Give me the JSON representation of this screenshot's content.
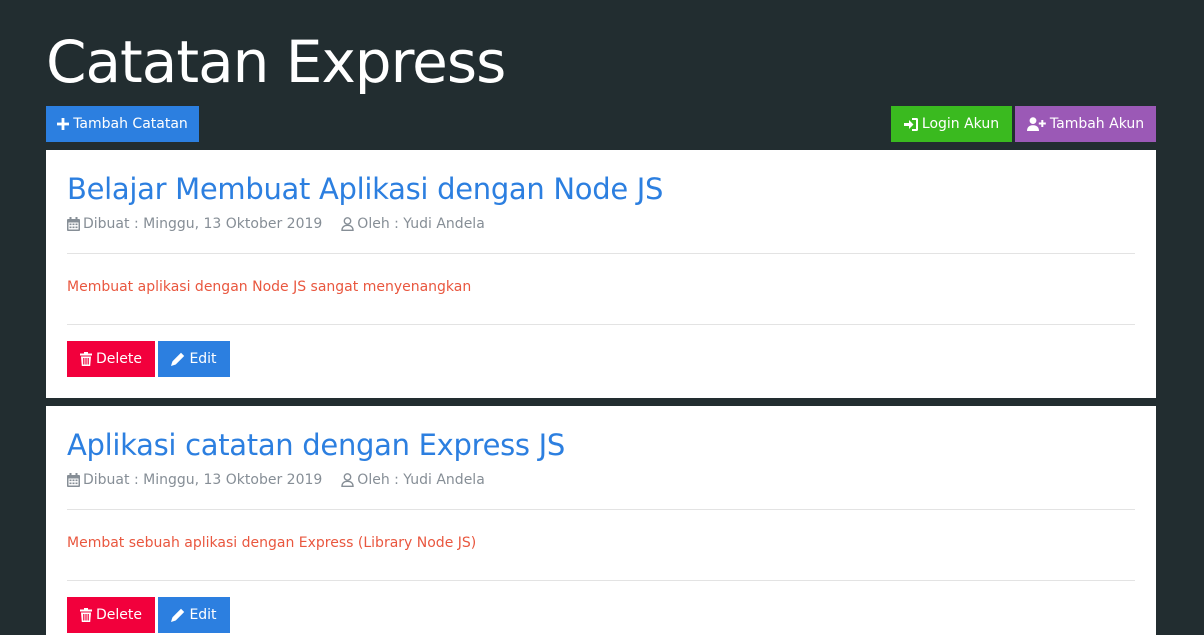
{
  "header": {
    "title": "Catatan Express",
    "add_note_label": "Tambah Catatan",
    "login_label": "Login Akun",
    "add_user_label": "Tambah Akun"
  },
  "notes": [
    {
      "title": "Belajar Membuat Aplikasi dengan Node JS",
      "created": "Dibuat : Minggu, 13 Oktober 2019",
      "author": "Oleh : Yudi Andela",
      "content": "Membuat aplikasi dengan Node JS sangat menyenangkan",
      "delete_label": "Delete",
      "edit_label": "Edit"
    },
    {
      "title": "Aplikasi catatan dengan Express JS",
      "created": "Dibuat : Minggu, 13 Oktober 2019",
      "author": "Oleh : Yudi Andela",
      "content": "Membat sebuah aplikasi dengan Express (Library Node JS)",
      "delete_label": "Delete",
      "edit_label": "Edit"
    }
  ],
  "icons": {
    "add_note": "plus-icon",
    "login": "sign-in-icon",
    "add_user": "user-plus-icon",
    "date": "calendar-icon",
    "author": "user-icon",
    "delete": "trash-icon",
    "edit": "pencil-icon"
  },
  "colors": {
    "background": "#222d30",
    "primary": "#2c7fe0",
    "success": "#3aba1f",
    "purple": "#9b59b6",
    "danger": "#f2003c",
    "content_text": "#e9573f",
    "muted": "#868e96"
  }
}
